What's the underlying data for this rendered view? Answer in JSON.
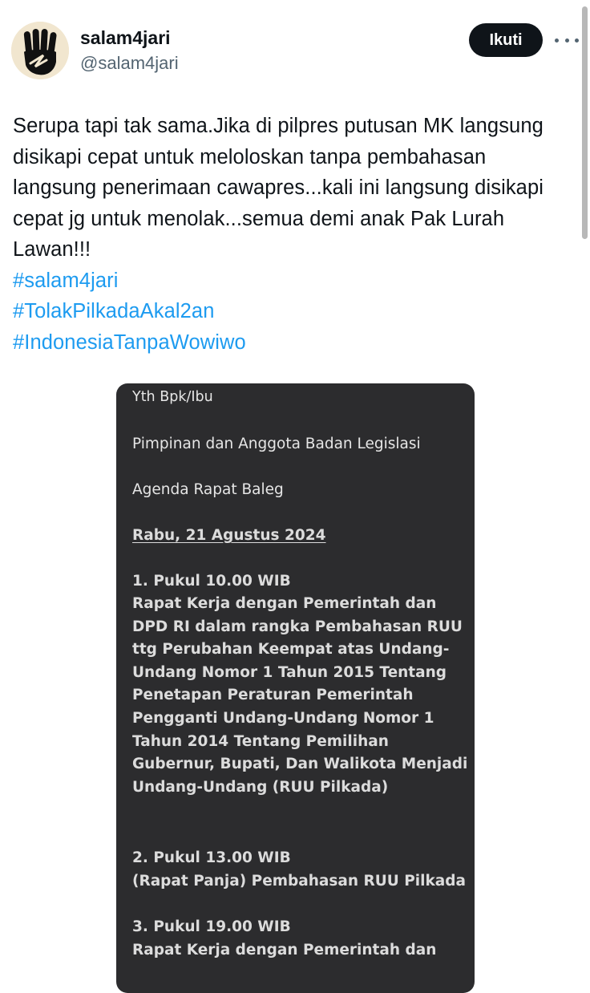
{
  "author": {
    "display_name": "salam4jari",
    "handle": "@salam4jari"
  },
  "actions": {
    "follow_label": "Ikuti"
  },
  "tweet": {
    "lines": [
      "Serupa tapi tak sama.Jika di pilpres putusan MK langsung",
      "disikapi cepat untuk meloloskan tanpa pembahasan",
      "langsung penerimaan cawapres...kali ini langsung disikapi",
      "cepat jg untuk menolak...semua demi anak Pak Lurah",
      "Lawan!!!"
    ],
    "hashtags": [
      "#salam4jari",
      "#TolakPilkadaAkal2an",
      "#IndonesiaTanpaWowiwo"
    ]
  },
  "attachment": {
    "greeting": "Yth Bpk/Ibu",
    "recipient": "Pimpinan dan Anggota Badan Legislasi",
    "agenda_title": "Agenda Rapat Baleg",
    "date": "Rabu, 21 Agustus 2024",
    "item1": {
      "time": "1. Pukul 10.00 WIB",
      "lines": [
        "Rapat Kerja dengan Pemerintah dan",
        "DPD RI dalam rangka Pembahasan RUU",
        "ttg Perubahan Keempat atas Undang-",
        "Undang Nomor 1 Tahun 2015 Tentang",
        "Penetapan Peraturan Pemerintah",
        "Pengganti Undang-Undang Nomor 1",
        "Tahun 2014 Tentang Pemilihan",
        "Gubernur, Bupati, Dan Walikota Menjadi",
        "Undang-Undang (RUU Pilkada)"
      ]
    },
    "item2": {
      "time": "2. Pukul 13.00 WIB",
      "line": "(Rapat Panja) Pembahasan RUU Pilkada"
    },
    "item3": {
      "time": "3. Pukul 19.00 WIB",
      "line": "Rapat Kerja dengan Pemerintah dan"
    }
  },
  "colors": {
    "link": "#1d9bf0",
    "secondary_text": "#536471",
    "attachment_bg": "#2c2c2e"
  }
}
